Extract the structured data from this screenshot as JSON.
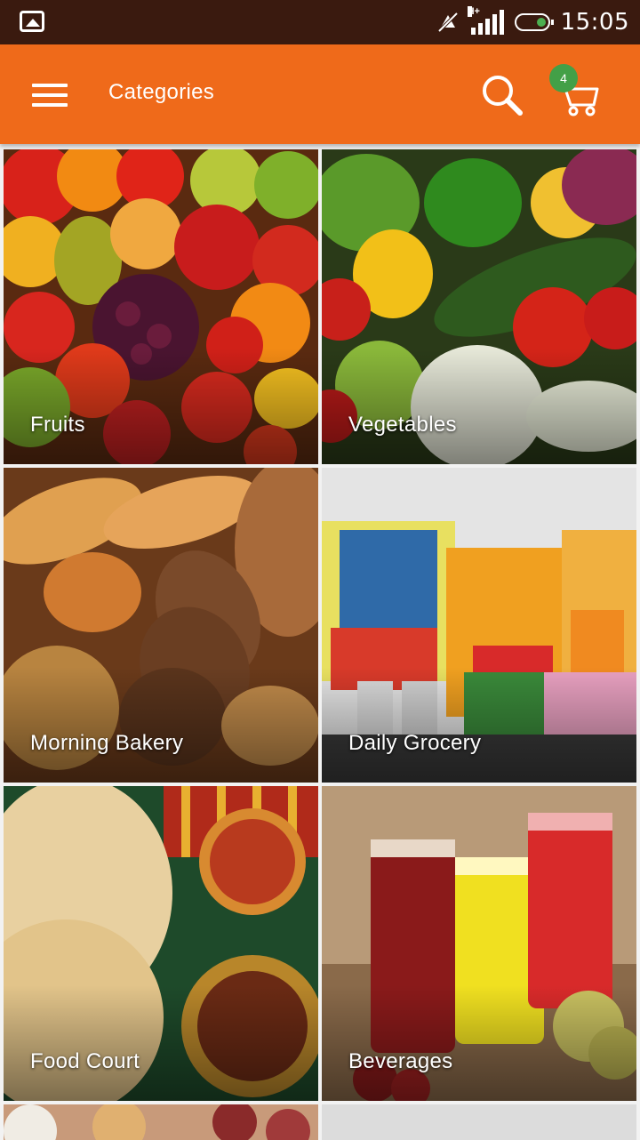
{
  "status_bar": {
    "time": "15:05",
    "network": "H+",
    "icons": [
      "gallery-icon",
      "mute-icon",
      "signal-icon",
      "battery-icon"
    ]
  },
  "toolbar": {
    "title": "Categories",
    "menu_icon": "hamburger-icon",
    "search_icon": "search-icon",
    "cart_icon": "cart-icon",
    "cart_count": "4"
  },
  "categories": [
    {
      "label": "Fruits"
    },
    {
      "label": "Vegetables"
    },
    {
      "label": "Morning Bakery"
    },
    {
      "label": "Daily Grocery"
    },
    {
      "label": "Food Court"
    },
    {
      "label": "Beverages"
    }
  ],
  "colors": {
    "toolbar": "#ef6a1a",
    "status_bar": "#3a1a0f",
    "badge": "#43a047"
  }
}
